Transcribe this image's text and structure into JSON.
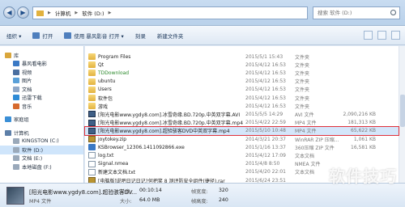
{
  "address": {
    "segments": [
      "计算机",
      "软件 (D:)"
    ],
    "search_placeholder": "搜索 软件 (D:)"
  },
  "toolbar": {
    "organize": "组织 ▾",
    "open": "打开",
    "play_with": "使用 暴风影音 打开 ▾",
    "burn": "刻录",
    "new_folder": "新建文件夹"
  },
  "sidebar": {
    "items": [
      {
        "label": "库",
        "level": 0,
        "icon": "library-icon"
      },
      {
        "label": "暴风看电影",
        "level": 1,
        "icon": "media-icon"
      },
      {
        "label": "视频",
        "level": 1,
        "icon": "video-icon"
      },
      {
        "label": "图片",
        "level": 1,
        "icon": "pictures-icon"
      },
      {
        "label": "文档",
        "level": 1,
        "icon": "documents-icon"
      },
      {
        "label": "迅雷下载",
        "level": 1,
        "icon": "download-icon"
      },
      {
        "label": "音乐",
        "level": 1,
        "icon": "music-icon"
      },
      {
        "label": "",
        "gap": true
      },
      {
        "label": "家庭组",
        "level": 0,
        "icon": "homegroup-icon"
      },
      {
        "label": "",
        "gap": true
      },
      {
        "label": "计算机",
        "level": 0,
        "icon": "computer-icon"
      },
      {
        "label": "KINGSTON (C:)",
        "level": 1,
        "icon": "drive-icon"
      },
      {
        "label": "软件 (D:)",
        "level": 1,
        "icon": "drive-icon",
        "selected": true
      },
      {
        "label": "文档 (E:)",
        "level": 1,
        "icon": "drive-icon"
      },
      {
        "label": "本地磁盘 (F:)",
        "level": 1,
        "icon": "drive-icon"
      }
    ]
  },
  "files": [
    {
      "name": "Program Files",
      "date": "2015/5/1 15:43",
      "type": "文件夹",
      "size": "",
      "icon": "folder"
    },
    {
      "name": "Qt",
      "date": "2015/4/12 16:53",
      "type": "文件夹",
      "size": "",
      "icon": "folder"
    },
    {
      "name": "TDDownload",
      "date": "2015/4/12 16:53",
      "type": "文件夹",
      "size": "",
      "icon": "folder",
      "green": true
    },
    {
      "name": "ubuntu",
      "date": "2015/4/12 16:53",
      "type": "文件夹",
      "size": "",
      "icon": "folder"
    },
    {
      "name": "Users",
      "date": "2015/4/12 16:53",
      "type": "文件夹",
      "size": "",
      "icon": "folder"
    },
    {
      "name": "软件包",
      "date": "2015/4/12 16:53",
      "type": "文件夹",
      "size": "",
      "icon": "folder"
    },
    {
      "name": "游戏",
      "date": "2015/4/12 16:53",
      "type": "文件夹",
      "size": "",
      "icon": "folder"
    },
    {
      "name": "[阳光电影www.ygdy8.com].冰雪奇缘.BD.720p.中英双字幕.AVI",
      "date": "2015/5/5 14:29",
      "type": "AVI 文件",
      "size": "2,090,216 KB",
      "icon": "vid"
    },
    {
      "name": "[阳光电影www.ygdy8.com].冰雪奇缘.BD.720p.中英双字幕.mp4",
      "date": "2015/4/22 22:59",
      "type": "MP4 文件",
      "size": "181,313 KB",
      "icon": "vid"
    },
    {
      "name": "[阳光电影www.ygdy8.com].超验骇客DVD中英双字幕.mp4",
      "date": "2015/5/10 10:48",
      "type": "MP4 文件",
      "size": "65,622 KB",
      "icon": "vid",
      "highlighted": true
    },
    {
      "name": "joytokey.zip",
      "date": "2014/3/21 20:37",
      "type": "WinRAR ZIP 压缩...",
      "size": "1,061 KB",
      "icon": "zip"
    },
    {
      "name": "KSBrowser_12306.1411092866.exe",
      "date": "2015/1/16 13:37",
      "type": "360压缩 ZIP 文件",
      "size": "16,581 KB",
      "icon": "app"
    },
    {
      "name": "log.txt",
      "date": "2015/4/12 17:09",
      "type": "文本文档",
      "size": "",
      "icon": "doc"
    },
    {
      "name": "Signal.nmea",
      "date": "2015/4/8 8:50",
      "type": "NMEA 文件",
      "size": "",
      "icon": "doc"
    },
    {
      "name": "新建文本文档.txt",
      "date": "2015/4/20 22:01",
      "type": "文本文档",
      "size": "",
      "icon": "doc"
    },
    {
      "name": "[电脑版]说吧日记日记?何把笑 8 测评防安全组件(捷径).rar",
      "date": "2015/6/24 23:51",
      "type": "",
      "size": "",
      "icon": "zip"
    }
  ],
  "details": {
    "name": "[阳光电影www.ygdy8.com].超验骇客DV...",
    "type": "MP4 文件",
    "length_label": "长度:",
    "length_value": "00:10:14",
    "size_label": "大小:",
    "size_value": "64.0 MB",
    "frame_width_label": "帧宽度:",
    "frame_width_value": "320",
    "frame_height_label": "帧高度:",
    "frame_height_value": "240"
  },
  "watermark": "软件技巧"
}
